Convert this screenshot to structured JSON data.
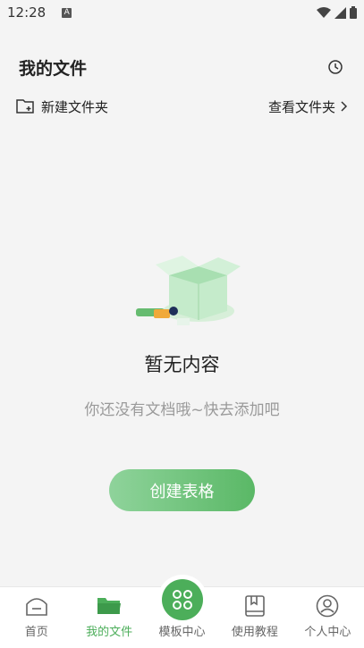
{
  "status_bar": {
    "time": "12:28",
    "notification_badge": "A"
  },
  "header": {
    "title": "我的文件"
  },
  "toolbar": {
    "new_folder_label": "新建文件夹",
    "view_folder_label": "查看文件夹"
  },
  "empty_state": {
    "title": "暂无内容",
    "subtitle": "你还没有文档哦~快去添加吧",
    "create_button_label": "创建表格"
  },
  "tabbar": {
    "items": [
      {
        "label": "首页",
        "icon": "home-icon"
      },
      {
        "label": "我的文件",
        "icon": "folder-icon"
      },
      {
        "label": "模板中心",
        "icon": "template-grid-icon"
      },
      {
        "label": "使用教程",
        "icon": "book-icon"
      },
      {
        "label": "个人中心",
        "icon": "user-icon"
      }
    ],
    "active_index": 1
  },
  "colors": {
    "accent": "#4cae5a",
    "background": "#f4f4f4"
  }
}
